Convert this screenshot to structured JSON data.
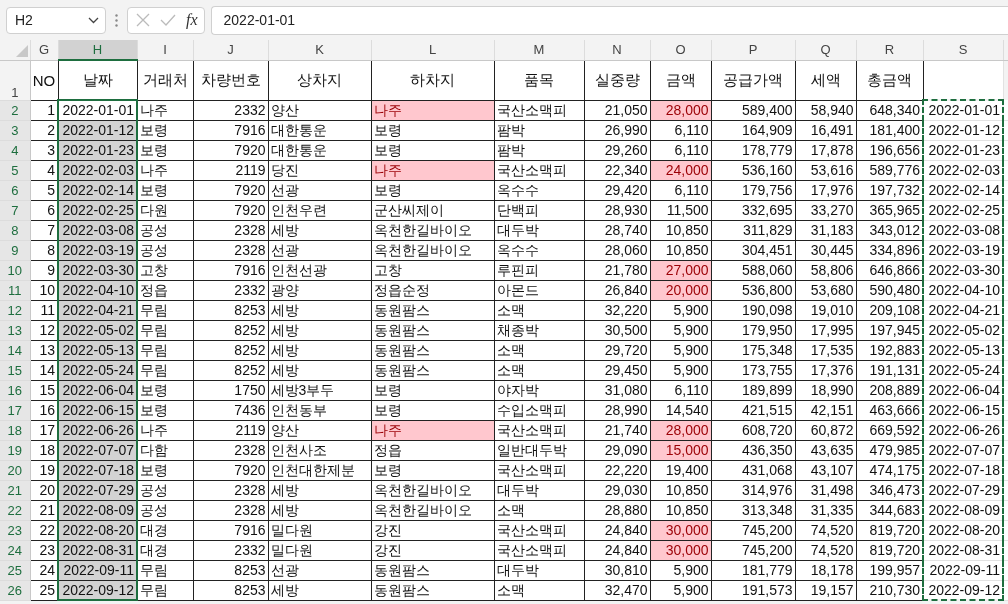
{
  "formula_bar": {
    "name_box": "H2",
    "function_button": "fx",
    "value": "2022-01-01"
  },
  "columns": [
    {
      "letter": "G",
      "selected": false,
      "copied": false
    },
    {
      "letter": "H",
      "selected": true,
      "copied": false
    },
    {
      "letter": "I",
      "selected": false,
      "copied": false
    },
    {
      "letter": "J",
      "selected": false,
      "copied": false
    },
    {
      "letter": "K",
      "selected": false,
      "copied": false
    },
    {
      "letter": "L",
      "selected": false,
      "copied": false
    },
    {
      "letter": "M",
      "selected": false,
      "copied": false
    },
    {
      "letter": "N",
      "selected": false,
      "copied": false
    },
    {
      "letter": "O",
      "selected": false,
      "copied": false
    },
    {
      "letter": "P",
      "selected": false,
      "copied": false
    },
    {
      "letter": "Q",
      "selected": false,
      "copied": false
    },
    {
      "letter": "R",
      "selected": false,
      "copied": false
    },
    {
      "letter": "S",
      "selected": false,
      "copied": true
    }
  ],
  "header_row": {
    "number": "1",
    "cells": [
      "NO",
      "날짜",
      "거래처",
      "차량번호",
      "상차지",
      "하차지",
      "품목",
      "실중량",
      "금액",
      "공급가액",
      "세액",
      "총금액"
    ]
  },
  "rows": [
    {
      "number": "2",
      "selected": true,
      "active": true,
      "unload_flagged": true,
      "amount_flagged": true,
      "cells": [
        "1",
        "2022-01-01",
        "나주",
        "2332",
        "양산",
        "나주",
        "국산소맥피",
        "21,050",
        "28,000",
        "589,400",
        "58,940",
        "648,340",
        "2022-01-01"
      ]
    },
    {
      "number": "3",
      "selected": true,
      "active": false,
      "unload_flagged": false,
      "amount_flagged": false,
      "cells": [
        "2",
        "2022-01-12",
        "보령",
        "7916",
        "대한통운",
        "보령",
        "팜박",
        "26,990",
        "6,110",
        "164,909",
        "16,491",
        "181,400",
        "2022-01-12"
      ]
    },
    {
      "number": "4",
      "selected": true,
      "active": false,
      "unload_flagged": false,
      "amount_flagged": false,
      "cells": [
        "3",
        "2022-01-23",
        "보령",
        "7920",
        "대한통운",
        "보령",
        "팜박",
        "29,260",
        "6,110",
        "178,779",
        "17,878",
        "196,656",
        "2022-01-23"
      ]
    },
    {
      "number": "5",
      "selected": true,
      "active": false,
      "unload_flagged": true,
      "amount_flagged": true,
      "cells": [
        "4",
        "2022-02-03",
        "나주",
        "2119",
        "당진",
        "나주",
        "국산소맥피",
        "22,340",
        "24,000",
        "536,160",
        "53,616",
        "589,776",
        "2022-02-03"
      ]
    },
    {
      "number": "6",
      "selected": true,
      "active": false,
      "unload_flagged": false,
      "amount_flagged": false,
      "cells": [
        "5",
        "2022-02-14",
        "보령",
        "7920",
        "선광",
        "보령",
        "옥수수",
        "29,420",
        "6,110",
        "179,756",
        "17,976",
        "197,732",
        "2022-02-14"
      ]
    },
    {
      "number": "7",
      "selected": true,
      "active": false,
      "unload_flagged": false,
      "amount_flagged": false,
      "cells": [
        "6",
        "2022-02-25",
        "다원",
        "7920",
        "인천우련",
        "군산씨제이",
        "단백피",
        "28,930",
        "11,500",
        "332,695",
        "33,270",
        "365,965",
        "2022-02-25"
      ]
    },
    {
      "number": "8",
      "selected": true,
      "active": false,
      "unload_flagged": false,
      "amount_flagged": false,
      "cells": [
        "7",
        "2022-03-08",
        "공성",
        "2328",
        "세방",
        "옥천한길바이오",
        "대두박",
        "28,740",
        "10,850",
        "311,829",
        "31,183",
        "343,012",
        "2022-03-08"
      ]
    },
    {
      "number": "9",
      "selected": true,
      "active": false,
      "unload_flagged": false,
      "amount_flagged": false,
      "cells": [
        "8",
        "2022-03-19",
        "공성",
        "2328",
        "선광",
        "옥천한길바이오",
        "옥수수",
        "28,060",
        "10,850",
        "304,451",
        "30,445",
        "334,896",
        "2022-03-19"
      ]
    },
    {
      "number": "10",
      "selected": true,
      "active": false,
      "unload_flagged": false,
      "amount_flagged": true,
      "cells": [
        "9",
        "2022-03-30",
        "고창",
        "7916",
        "인천선광",
        "고창",
        "루핀피",
        "21,780",
        "27,000",
        "588,060",
        "58,806",
        "646,866",
        "2022-03-30"
      ]
    },
    {
      "number": "11",
      "selected": true,
      "active": false,
      "unload_flagged": false,
      "amount_flagged": true,
      "cells": [
        "10",
        "2022-04-10",
        "정읍",
        "2332",
        "광양",
        "정읍순정",
        "아몬드",
        "26,840",
        "20,000",
        "536,800",
        "53,680",
        "590,480",
        "2022-04-10"
      ]
    },
    {
      "number": "12",
      "selected": true,
      "active": false,
      "unload_flagged": false,
      "amount_flagged": false,
      "cells": [
        "11",
        "2022-04-21",
        "무림",
        "8253",
        "세방",
        "동원팜스",
        "소맥",
        "32,220",
        "5,900",
        "190,098",
        "19,010",
        "209,108",
        "2022-04-21"
      ]
    },
    {
      "number": "13",
      "selected": true,
      "active": false,
      "unload_flagged": false,
      "amount_flagged": false,
      "cells": [
        "12",
        "2022-05-02",
        "무림",
        "8252",
        "세방",
        "동원팜스",
        "채종박",
        "30,500",
        "5,900",
        "179,950",
        "17,995",
        "197,945",
        "2022-05-02"
      ]
    },
    {
      "number": "14",
      "selected": true,
      "active": false,
      "unload_flagged": false,
      "amount_flagged": false,
      "cells": [
        "13",
        "2022-05-13",
        "무림",
        "8252",
        "세방",
        "동원팜스",
        "소맥",
        "29,720",
        "5,900",
        "175,348",
        "17,535",
        "192,883",
        "2022-05-13"
      ]
    },
    {
      "number": "15",
      "selected": true,
      "active": false,
      "unload_flagged": false,
      "amount_flagged": false,
      "cells": [
        "14",
        "2022-05-24",
        "무림",
        "8252",
        "세방",
        "동원팜스",
        "소맥",
        "29,450",
        "5,900",
        "173,755",
        "17,376",
        "191,131",
        "2022-05-24"
      ]
    },
    {
      "number": "16",
      "selected": true,
      "active": false,
      "unload_flagged": false,
      "amount_flagged": false,
      "cells": [
        "15",
        "2022-06-04",
        "보령",
        "1750",
        "세방3부두",
        "보령",
        "야자박",
        "31,080",
        "6,110",
        "189,899",
        "18,990",
        "208,889",
        "2022-06-04"
      ]
    },
    {
      "number": "17",
      "selected": true,
      "active": false,
      "unload_flagged": false,
      "amount_flagged": false,
      "cells": [
        "16",
        "2022-06-15",
        "보령",
        "7436",
        "인천동부",
        "보령",
        "수입소맥피",
        "28,990",
        "14,540",
        "421,515",
        "42,151",
        "463,666",
        "2022-06-15"
      ]
    },
    {
      "number": "18",
      "selected": true,
      "active": false,
      "unload_flagged": true,
      "amount_flagged": true,
      "cells": [
        "17",
        "2022-06-26",
        "나주",
        "2119",
        "양산",
        "나주",
        "국산소맥피",
        "21,740",
        "28,000",
        "608,720",
        "60,872",
        "669,592",
        "2022-06-26"
      ]
    },
    {
      "number": "19",
      "selected": true,
      "active": false,
      "unload_flagged": false,
      "amount_flagged": true,
      "cells": [
        "18",
        "2022-07-07",
        "다함",
        "2328",
        "인천사조",
        "정읍",
        "일반대두박",
        "29,090",
        "15,000",
        "436,350",
        "43,635",
        "479,985",
        "2022-07-07"
      ]
    },
    {
      "number": "20",
      "selected": true,
      "active": false,
      "unload_flagged": false,
      "amount_flagged": false,
      "cells": [
        "19",
        "2022-07-18",
        "보령",
        "7920",
        "인천대한제분",
        "보령",
        "국산소맥피",
        "22,220",
        "19,400",
        "431,068",
        "43,107",
        "474,175",
        "2022-07-18"
      ]
    },
    {
      "number": "21",
      "selected": true,
      "active": false,
      "unload_flagged": false,
      "amount_flagged": false,
      "cells": [
        "20",
        "2022-07-29",
        "공성",
        "2328",
        "세방",
        "옥천한길바이오",
        "대두박",
        "29,030",
        "10,850",
        "314,976",
        "31,498",
        "346,473",
        "2022-07-29"
      ]
    },
    {
      "number": "22",
      "selected": true,
      "active": false,
      "unload_flagged": false,
      "amount_flagged": false,
      "cells": [
        "21",
        "2022-08-09",
        "공성",
        "2328",
        "세방",
        "옥천한길바이오",
        "소맥",
        "28,880",
        "10,850",
        "313,348",
        "31,335",
        "344,683",
        "2022-08-09"
      ]
    },
    {
      "number": "23",
      "selected": true,
      "active": false,
      "unload_flagged": false,
      "amount_flagged": true,
      "cells": [
        "22",
        "2022-08-20",
        "대경",
        "7916",
        "밀다원",
        "강진",
        "국산소맥피",
        "24,840",
        "30,000",
        "745,200",
        "74,520",
        "819,720",
        "2022-08-20"
      ]
    },
    {
      "number": "24",
      "selected": true,
      "active": false,
      "unload_flagged": false,
      "amount_flagged": true,
      "cells": [
        "23",
        "2022-08-31",
        "대경",
        "2332",
        "밀다원",
        "강진",
        "국산소맥피",
        "24,840",
        "30,000",
        "745,200",
        "74,520",
        "819,720",
        "2022-08-31"
      ]
    },
    {
      "number": "25",
      "selected": true,
      "active": false,
      "unload_flagged": false,
      "amount_flagged": false,
      "cells": [
        "24",
        "2022-09-11",
        "무림",
        "8253",
        "선광",
        "동원팜스",
        "대두박",
        "30,810",
        "5,900",
        "181,779",
        "18,178",
        "199,957",
        "2022-09-11"
      ]
    },
    {
      "number": "26",
      "selected": true,
      "active": false,
      "unload_flagged": false,
      "amount_flagged": false,
      "cells": [
        "25",
        "2022-09-12",
        "무림",
        "8253",
        "세방",
        "동원팜스",
        "소맥",
        "32,470",
        "5,900",
        "191,573",
        "19,157",
        "210,730",
        "2022-09-12"
      ]
    }
  ]
}
